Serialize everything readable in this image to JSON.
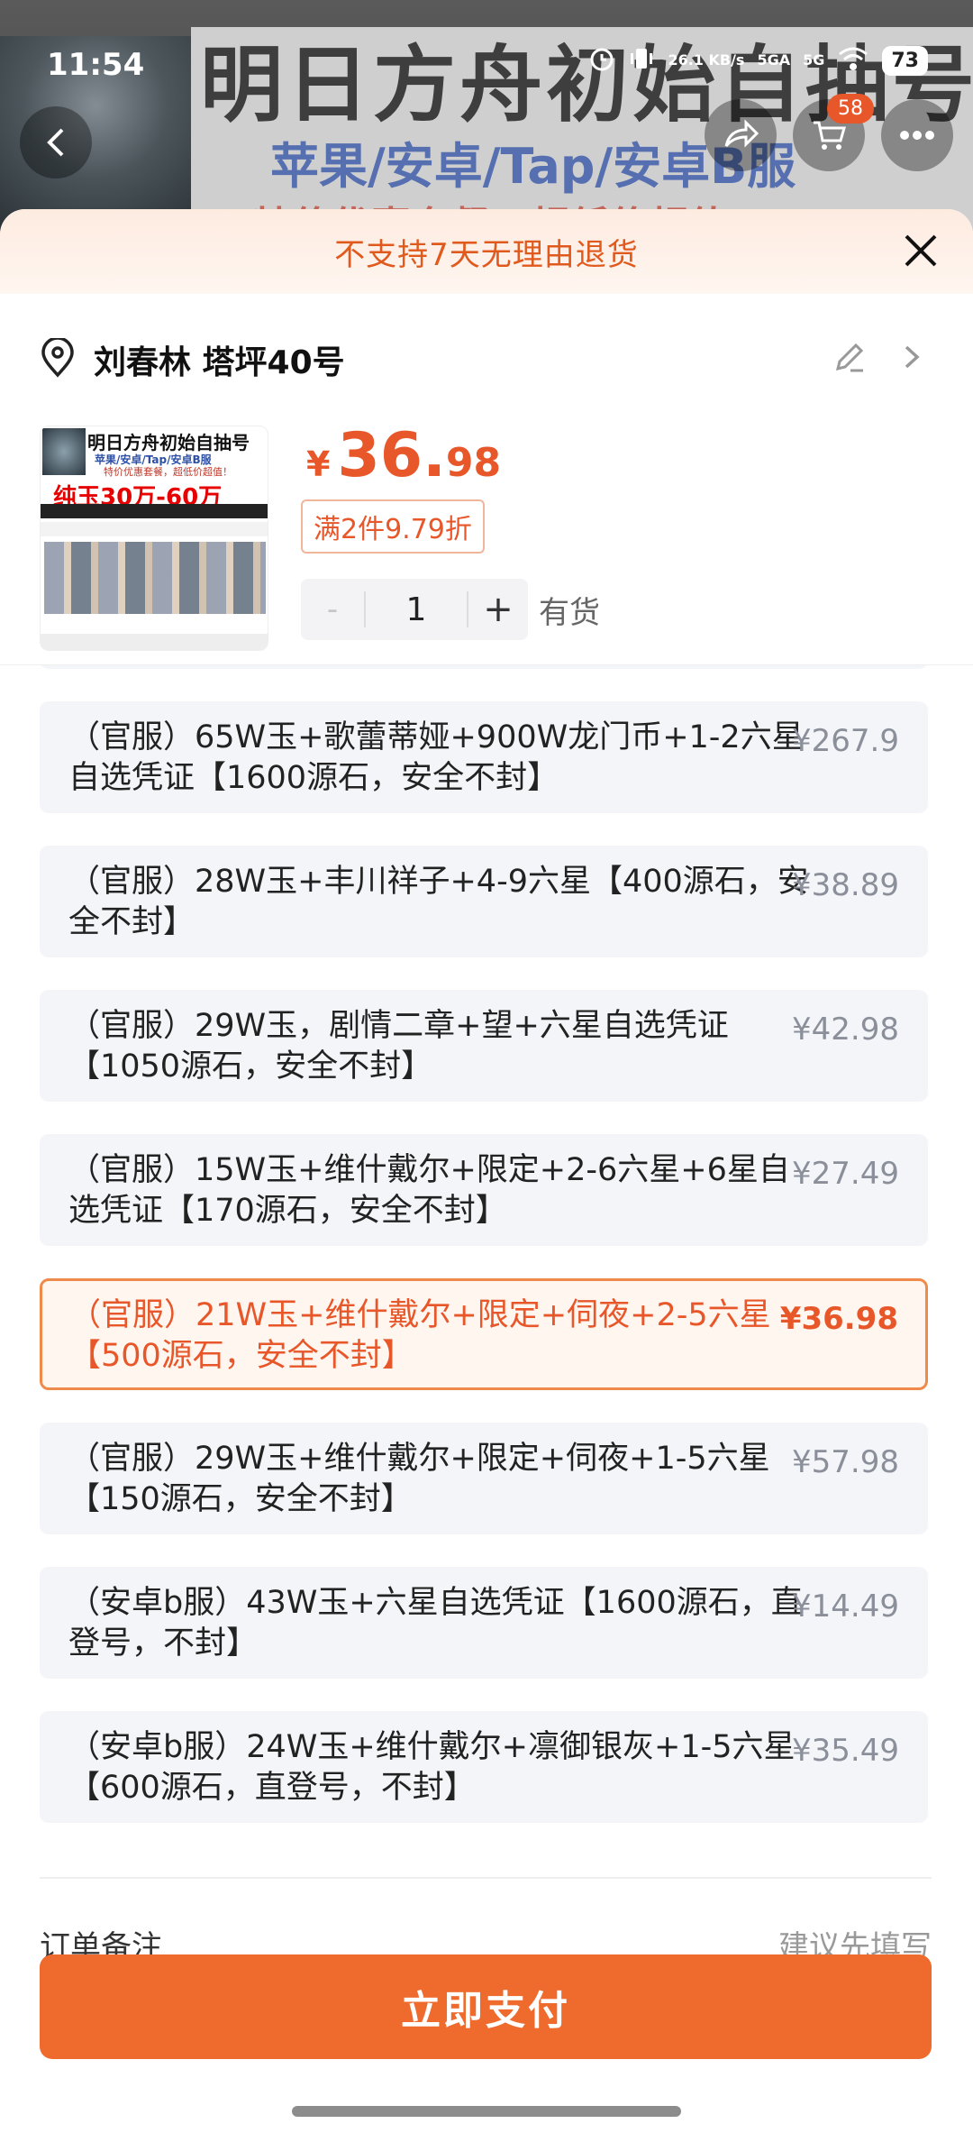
{
  "status_bar": {
    "time": "11:54",
    "net_speed": "26.1 KB/s",
    "signal1": "5GA",
    "signal2": "5G",
    "battery": "73"
  },
  "background": {
    "title": "明日方舟初始自抽号",
    "subtitle": "苹果/安卓/Tap/安卓B服",
    "red_line": "特价优惠套餐，超低价超值！",
    "cart_badge": "58"
  },
  "sheet": {
    "notice": "不支持7天无理由退货",
    "address": "刘春林 塔坪40号",
    "thumb": {
      "title": "明日方舟初始自抽号",
      "sub": "苹果/安卓/Tap/安卓B服",
      "sub2": "特价优惠套餐，超低价超值！",
      "big": "纯玉30万-60万"
    },
    "price": {
      "symbol": "¥",
      "int": "36.",
      "dec": "98"
    },
    "discount": "满2件9.79折",
    "qty": {
      "minus": "-",
      "value": "1",
      "plus": "+"
    },
    "stock": "有货",
    "options": [
      {
        "text": "（官服）65W玉+歌蕾蒂娅+900W龙门币+1-2六星自选凭证【1600源石，安全不封】",
        "price": "¥267.9",
        "selected": false
      },
      {
        "text": "（官服）28W玉+丰川祥子+4-9六星【400源石，安全不封】",
        "price": "¥38.89",
        "selected": false
      },
      {
        "text": "（官服）29W玉，剧情二章+望+六星自选凭证【1050源石，安全不封】",
        "price": "¥42.98",
        "selected": false
      },
      {
        "text": "（官服）15W玉+维什戴尔+限定+2-6六星+6星自选凭证【170源石，安全不封】",
        "price": "¥27.49",
        "selected": false
      },
      {
        "text": "（官服）21W玉+维什戴尔+限定+伺夜+2-5六星【500源石，安全不封】",
        "price": "¥36.98",
        "selected": true
      },
      {
        "text": "（官服）29W玉+维什戴尔+限定+伺夜+1-5六星【150源石，安全不封】",
        "price": "¥57.98",
        "selected": false
      },
      {
        "text": "（安卓b服）43W玉+六星自选凭证【1600源石，直登号，不封】",
        "price": "¥14.49",
        "selected": false
      },
      {
        "text": "（安卓b服）24W玉+维什戴尔+凛御银灰+1-5六星【600源石，直登号，不封】",
        "price": "¥35.49",
        "selected": false
      }
    ],
    "peek_left": "订单备注",
    "peek_right": "建议先填写",
    "pay_label": "立即支付"
  },
  "colors": {
    "accent": "#ef6a2d",
    "price": "#e8572a",
    "notice_bg": "#fdebe0"
  }
}
